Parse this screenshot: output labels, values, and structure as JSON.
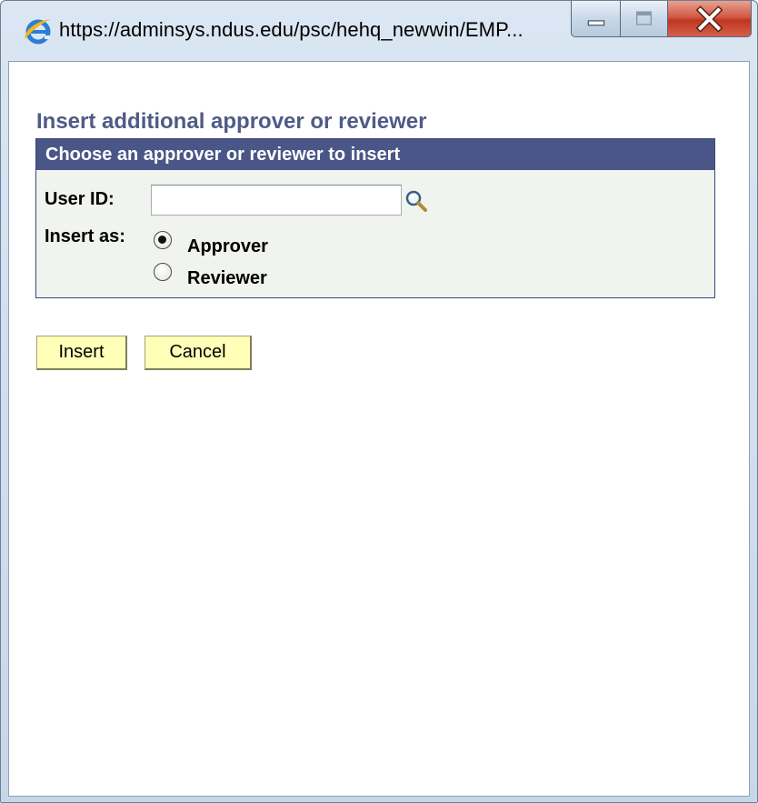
{
  "window": {
    "title": "https://adminsys.ndus.edu/psc/hehq_newwin/EMP...",
    "icon": "ie-icon",
    "controls": {
      "minimize": "minimize-icon",
      "maximize": "maximize-icon",
      "close": "close-icon"
    },
    "colors": {
      "frame": "#c7d7ea",
      "close_button": "#c8432c"
    }
  },
  "page": {
    "title": "Insert additional approver or reviewer",
    "title_color": "#4f5b86"
  },
  "panel": {
    "header": "Choose an approver or reviewer to insert",
    "header_color": "#4a5687",
    "background": "#f0f3ee",
    "user_id_label": "User ID:",
    "user_id_value": "",
    "lookup_icon": "magnifying-glass-icon",
    "insert_as_label": "Insert as:",
    "options": [
      {
        "label": "Approver",
        "selected": true
      },
      {
        "label": "Reviewer",
        "selected": false
      }
    ]
  },
  "buttons": {
    "insert": "Insert",
    "cancel": "Cancel",
    "color": "#ffffb8"
  }
}
